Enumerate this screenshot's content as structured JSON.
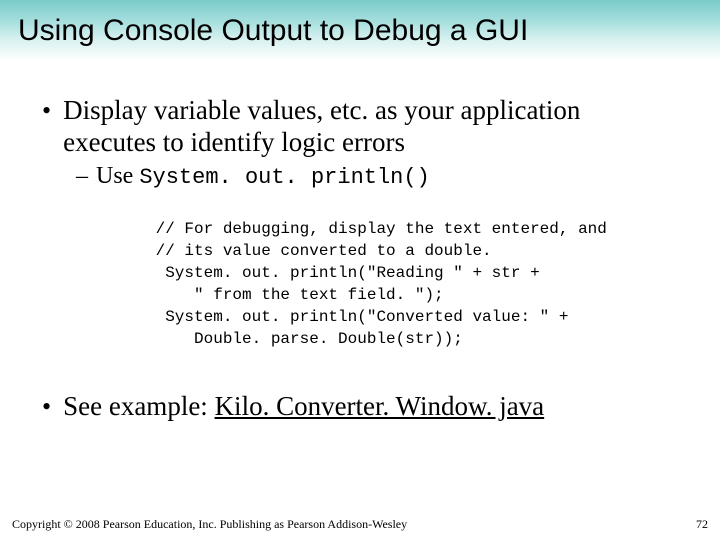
{
  "title": "Using Console Output to Debug a GUI",
  "bullet_main": "Display variable values, etc. as your application executes to identify logic errors",
  "sub_prefix": "Use ",
  "sub_code": "System. out. println()",
  "code": " // For debugging, display the text entered, and\n // its value converted to a double.\n  System. out. println(\"Reading \" + str +\n     \" from the text field. \");\n  System. out. println(\"Converted value: \" +\n     Double. parse. Double(str));",
  "see_prefix": "See example: ",
  "see_link": "Kilo. Converter. Window. java",
  "copyright": "Copyright © 2008 Pearson Education, Inc. Publishing as Pearson Addison-Wesley",
  "page_number": "72"
}
